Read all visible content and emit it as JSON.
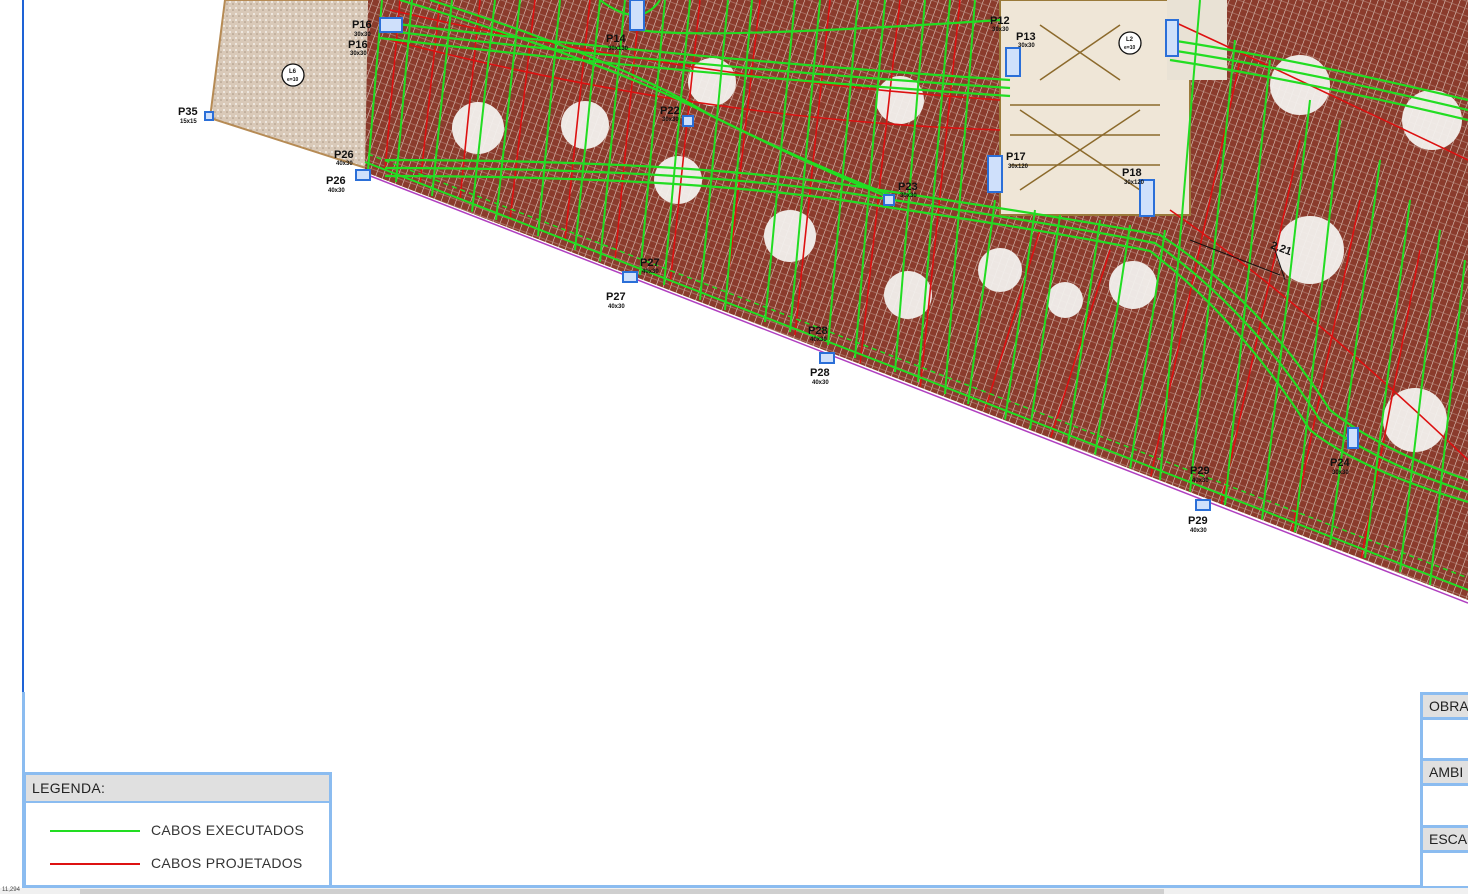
{
  "legend": {
    "title": "LEGENDA:",
    "items": [
      {
        "label": "CABOS EXECUTADOS",
        "color": "#22dd22"
      },
      {
        "label": "CABOS PROJETADOS",
        "color": "#dd1111"
      }
    ]
  },
  "title_block": {
    "obra": "OBRA",
    "ambiente": "AMBI",
    "escala": "ESCA"
  },
  "status": {
    "coords": "11,294"
  },
  "colors": {
    "executed": "#22dd22",
    "projected": "#dd1111",
    "pillar": "#2b6fd8",
    "slab": "#8a3b2c"
  },
  "pillars": [
    {
      "id": "p16",
      "label": "P16",
      "dim": "30x30"
    },
    {
      "id": "p16b",
      "label": "P16",
      "dim": "30x30"
    },
    {
      "id": "p35",
      "label": "P35",
      "dim": "15x15"
    },
    {
      "id": "p26",
      "label": "P26",
      "dim": "40x30"
    },
    {
      "id": "p26b",
      "label": "P26",
      "dim": "40x30"
    },
    {
      "id": "p14",
      "label": "P14",
      "dim": "30x130"
    },
    {
      "id": "p22",
      "label": "P22",
      "dim": "30x30"
    },
    {
      "id": "p27",
      "label": "P27",
      "dim": "40x30"
    },
    {
      "id": "p27b",
      "label": "P27",
      "dim": "40x30"
    },
    {
      "id": "p23",
      "label": "P23",
      "dim": "30x30"
    },
    {
      "id": "p28",
      "label": "P28",
      "dim": "40x30"
    },
    {
      "id": "p28b",
      "label": "P28",
      "dim": "40x30"
    },
    {
      "id": "p13",
      "label": "P13",
      "dim": "30x30"
    },
    {
      "id": "p12",
      "label": "P12",
      "dim": "30x30"
    },
    {
      "id": "p17",
      "label": "P17",
      "dim": "30x120"
    },
    {
      "id": "p18",
      "label": "P18",
      "dim": "30x120"
    },
    {
      "id": "p29",
      "label": "P29",
      "dim": "40x30"
    },
    {
      "id": "p29b",
      "label": "P29",
      "dim": "40x30"
    },
    {
      "id": "p24",
      "label": "P24",
      "dim": "30x30"
    }
  ],
  "callouts": [
    {
      "id": "lj1",
      "label": "L6",
      "sub": "e=10"
    },
    {
      "id": "lj2",
      "label": "L2",
      "sub": "e=10"
    }
  ],
  "dimension": {
    "label": "2.21"
  }
}
